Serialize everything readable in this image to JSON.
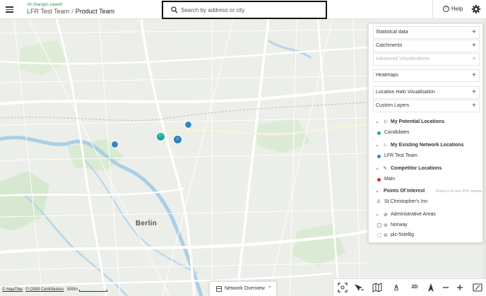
{
  "header": {
    "save_status": "All changes saved!",
    "team": "LFR Test Team",
    "separator": "/",
    "project": "Product Team",
    "help_label": "Help"
  },
  "search": {
    "placeholder": "Search by address or city"
  },
  "map": {
    "city_label": "Berlin",
    "marker_glyphs": {
      "potential": "⚐",
      "existing": "⌂"
    }
  },
  "panel": {
    "sections": [
      {
        "label": "Statistical data",
        "action": "+"
      },
      {
        "label": "Catchments",
        "action": "+"
      },
      {
        "label": "Advanced Visualisations",
        "action": "+"
      },
      {
        "label": "Heatmaps",
        "action": "+"
      },
      {
        "label": "Location Halo Visualisation",
        "action": "+"
      },
      {
        "label": "Custom Layers",
        "action": "+"
      }
    ],
    "groups": {
      "potential": {
        "label": "My Potential Locations",
        "item": "Candidates",
        "color": "#1aa79a"
      },
      "existing": {
        "label": "My Existing Network Locations",
        "item": "LFR Test Team",
        "color": "#3b82c4"
      },
      "competitor": {
        "label": "Competitor Locations",
        "item": "Main",
        "color": "#d62828"
      },
      "poi": {
        "label": "Points Of Interest",
        "hint": "Zoom in to see POI names",
        "item": "St Christopher's Inn"
      },
      "admin": {
        "label": "Administrative Areas",
        "items": [
          "Norway",
          "plz-5stellig"
        ]
      }
    }
  },
  "footer": {
    "attribution": [
      "© MapTiler",
      "© OSM Contributors"
    ],
    "scale_label": "500m",
    "network_overview": "Network Overview",
    "toolbar": {
      "view_mode": "2D",
      "label_tool": "A"
    }
  },
  "colors": {
    "accent": "#3b82c4",
    "teal": "#1aa79a",
    "competitor": "#d62828",
    "saved": "#2e9e4f"
  }
}
